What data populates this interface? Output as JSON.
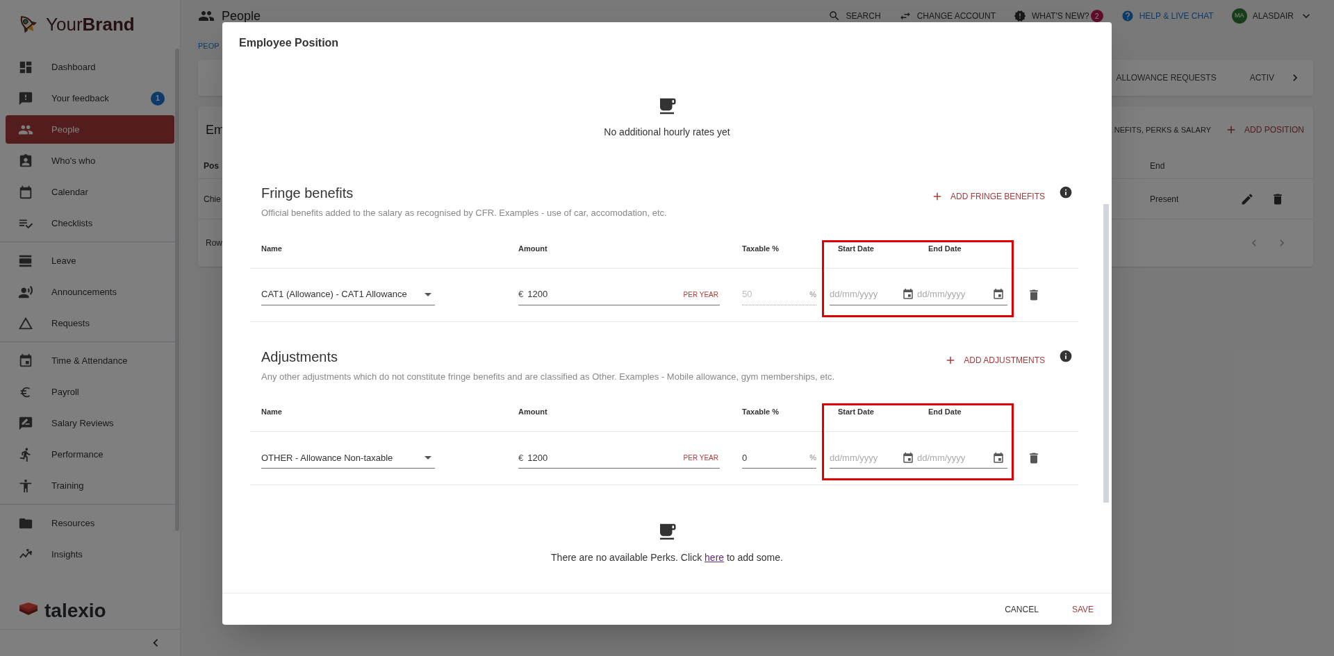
{
  "sidebar": {
    "brand": "Your**Brand**",
    "groups": [
      [
        {
          "label": "Dashboard",
          "selected": false
        },
        {
          "label": "Your feedback",
          "selected": false,
          "badge": "1"
        },
        {
          "label": "People",
          "selected": true
        },
        {
          "label": "Who's who",
          "selected": false
        },
        {
          "label": "Calendar",
          "selected": false
        },
        {
          "label": "Checklists",
          "selected": false
        }
      ],
      [
        {
          "label": "Leave",
          "selected": false
        },
        {
          "label": "Announcements",
          "selected": false
        },
        {
          "label": "Requests",
          "selected": false
        }
      ],
      [
        {
          "label": "Time & Attendance",
          "selected": false
        },
        {
          "label": "Payroll",
          "selected": false
        },
        {
          "label": "Salary Reviews",
          "selected": false
        },
        {
          "label": "Performance",
          "selected": false
        },
        {
          "label": "Training",
          "selected": false
        }
      ],
      [
        {
          "label": "Resources",
          "selected": false
        },
        {
          "label": "Insights",
          "selected": false
        }
      ]
    ],
    "footer_logo": "talexio"
  },
  "header": {
    "title": "People",
    "actions": [
      {
        "label": "SEARCH"
      },
      {
        "label": "CHANGE ACCOUNT"
      },
      {
        "label": "WHAT'S NEW?",
        "badge": "2"
      },
      {
        "label": "HELP & LIVE CHAT"
      }
    ],
    "user": {
      "initials": "MA",
      "name": "ALASDAIR"
    }
  },
  "breadcrumb": "PEOP",
  "tabs": [
    "ALLOWANCE REQUESTS",
    "ACTIV"
  ],
  "positions_card": {
    "title": "Em",
    "actions": [
      "NEFITS, PERKS & SALARY",
      "ADD POSITION"
    ],
    "columns": [
      "Pos",
      "End"
    ],
    "rows": [
      {
        "position": "Chie",
        "end": "Present"
      }
    ],
    "footer": "Row"
  },
  "modal": {
    "title": "Employee Position",
    "hourly_empty": "No additional hourly rates yet",
    "sections": [
      {
        "title": "Fringe benefits",
        "description": "Official benefits added to the salary as recognised by CFR. Examples - use of car, accomodation, etc.",
        "add_label": "ADD FRINGE BENEFITS",
        "columns": [
          "Name",
          "Amount",
          "Taxable %",
          "Start Date",
          "End Date"
        ],
        "highlighted": true,
        "rows": [
          {
            "name": "CAT1 (Allowance) - CAT1 Allowance",
            "currency": "€",
            "amount": "1200",
            "period": "PER YEAR",
            "taxable": "50",
            "taxable_unit": "%",
            "taxable_disabled": true,
            "start_placeholder": "dd/mm/yyyy",
            "end_placeholder": "dd/mm/yyyy"
          }
        ]
      },
      {
        "title": "Adjustments",
        "description": "Any other adjustments which do not constitute fringe benefits and are classified as Other. Examples - Mobile allowance, gym memberships, etc.",
        "add_label": "ADD ADJUSTMENTS",
        "columns": [
          "Name",
          "Amount",
          "Taxable %",
          "Start Date",
          "End Date"
        ],
        "highlighted": true,
        "rows": [
          {
            "name": "OTHER - Allowance Non-taxable",
            "currency": "€",
            "amount": "1200",
            "period": "PER YEAR",
            "taxable": "0",
            "taxable_unit": "%",
            "taxable_disabled": false,
            "start_placeholder": "dd/mm/yyyy",
            "end_placeholder": "dd/mm/yyyy"
          }
        ]
      }
    ],
    "perks_empty": {
      "before": "There are no available Perks. Click ",
      "link": "here",
      "after": " to add some."
    },
    "buttons": [
      "CANCEL",
      "SAVE"
    ]
  }
}
